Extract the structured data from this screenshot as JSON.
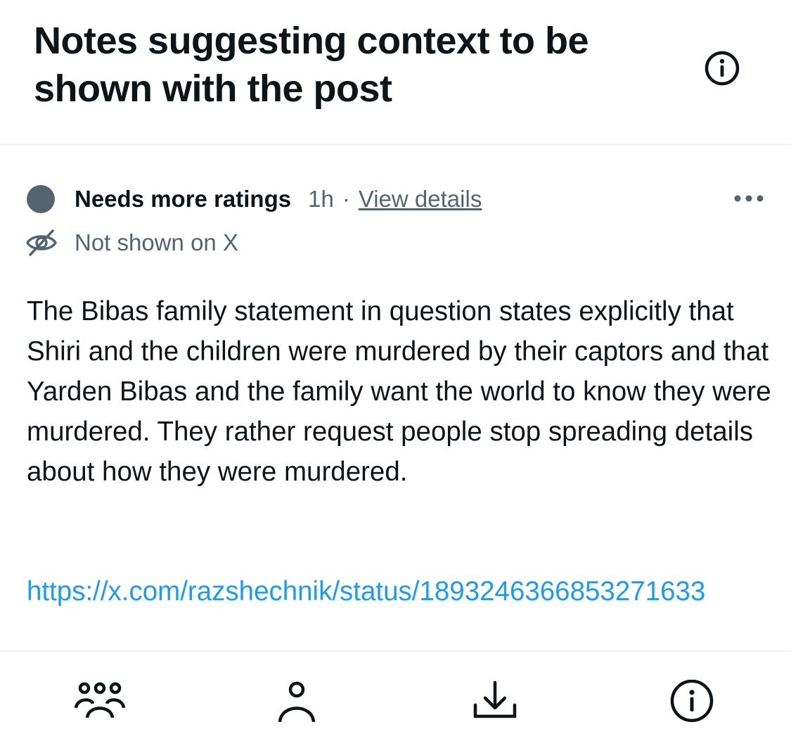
{
  "header": {
    "title": "Notes suggesting context to be shown with the post",
    "info_icon": "info-icon"
  },
  "note": {
    "status": "Needs more ratings",
    "status_color": "#536471",
    "time": "1h",
    "separator": "·",
    "view_details": "View details",
    "more_icon": "more-horizontal-icon",
    "visibility": "Not shown on X",
    "visibility_icon": "eye-off-icon",
    "body": "The Bibas family statement in question states explicitly that Shiri and the children were murdered by their captors and that Yarden Bibas and the family want the world to know they were murdered. They rather request people stop spreading details about how they were murdered.",
    "link": "https://x.com/razshechnik/status/1893246366853271633",
    "link_color": "#1d9bf0"
  },
  "bottom_nav": {
    "items": [
      {
        "icon": "community-icon"
      },
      {
        "icon": "profile-icon"
      },
      {
        "icon": "download-icon"
      },
      {
        "icon": "info-icon"
      }
    ]
  }
}
